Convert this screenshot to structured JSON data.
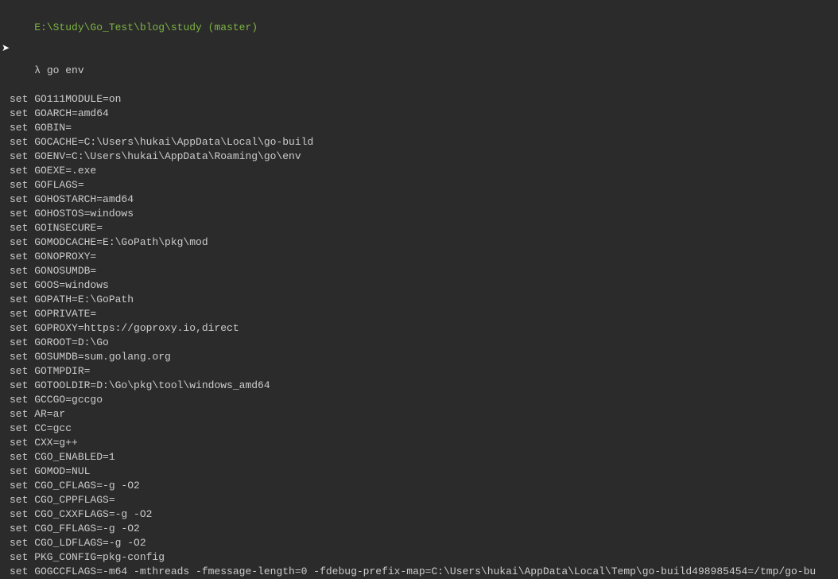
{
  "prompt": {
    "path": "E:\\Study\\Go_Test\\blog\\study",
    "branch": "(master)",
    "symbol": "λ",
    "command": "go env"
  },
  "output": [
    "set GO111MODULE=on",
    "set GOARCH=amd64",
    "set GOBIN=",
    "set GOCACHE=C:\\Users\\hukai\\AppData\\Local\\go-build",
    "set GOENV=C:\\Users\\hukai\\AppData\\Roaming\\go\\env",
    "set GOEXE=.exe",
    "set GOFLAGS=",
    "set GOHOSTARCH=amd64",
    "set GOHOSTOS=windows",
    "set GOINSECURE=",
    "set GOMODCACHE=E:\\GoPath\\pkg\\mod",
    "set GONOPROXY=",
    "set GONOSUMDB=",
    "set GOOS=windows",
    "set GOPATH=E:\\GoPath",
    "set GOPRIVATE=",
    "set GOPROXY=https://goproxy.io,direct",
    "set GOROOT=D:\\Go",
    "set GOSUMDB=sum.golang.org",
    "set GOTMPDIR=",
    "set GOTOOLDIR=D:\\Go\\pkg\\tool\\windows_amd64",
    "set GCCGO=gccgo",
    "set AR=ar",
    "set CC=gcc",
    "set CXX=g++",
    "set CGO_ENABLED=1",
    "set GOMOD=NUL",
    "set CGO_CFLAGS=-g -O2",
    "set CGO_CPPFLAGS=",
    "set CGO_CXXFLAGS=-g -O2",
    "set CGO_FFLAGS=-g -O2",
    "set CGO_LDFLAGS=-g -O2",
    "set PKG_CONFIG=pkg-config",
    "set GOGCCFLAGS=-m64 -mthreads -fmessage-length=0 -fdebug-prefix-map=C:\\Users\\hukai\\AppData\\Local\\Temp\\go-build498985454=/tmp/go-bu"
  ]
}
